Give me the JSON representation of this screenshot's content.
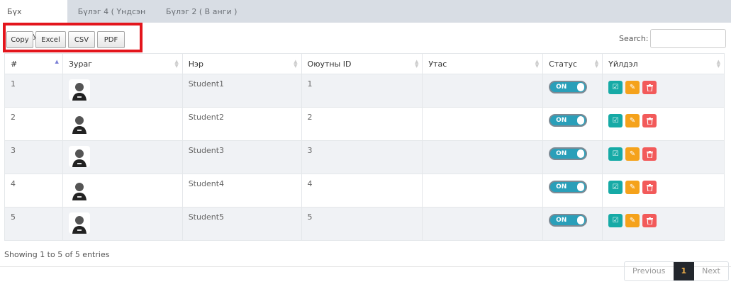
{
  "tabs": [
    {
      "label": "Бүх оюутнууд",
      "active": true
    },
    {
      "label": "Бүлэг 4 ( Үндсэн )"
    },
    {
      "label": "Бүлэг 2 ( В анги )"
    }
  ],
  "toolbar": {
    "copy": "Copy",
    "excel": "Excel",
    "csv": "CSV",
    "pdf": "PDF"
  },
  "search": {
    "label": "Search:",
    "value": ""
  },
  "columns": [
    "#",
    "Зураг",
    "Нэр",
    "Оюутны ID",
    "Утас",
    "Статус",
    "Үйлдэл"
  ],
  "rows": [
    {
      "num": "1",
      "name": "Student1",
      "id": "1",
      "phone": "",
      "status": "ON"
    },
    {
      "num": "2",
      "name": "Student2",
      "id": "2",
      "phone": "",
      "status": "ON"
    },
    {
      "num": "3",
      "name": "Student3",
      "id": "3",
      "phone": "",
      "status": "ON"
    },
    {
      "num": "4",
      "name": "Student4",
      "id": "4",
      "phone": "",
      "status": "ON"
    },
    {
      "num": "5",
      "name": "Student5",
      "id": "5",
      "phone": "",
      "status": "ON"
    }
  ],
  "action_icons": [
    "check-square-icon",
    "edit-icon",
    "trash-icon"
  ],
  "colors": {
    "view": "#16aaa6",
    "edit": "#f5a21b",
    "delete": "#f25a5a",
    "toggle": "#2a9fb9",
    "highlight": "#e3151c"
  },
  "footer": {
    "info": "Showing 1 to 5 of 5 entries",
    "previous": "Previous",
    "page": "1",
    "next": "Next"
  }
}
